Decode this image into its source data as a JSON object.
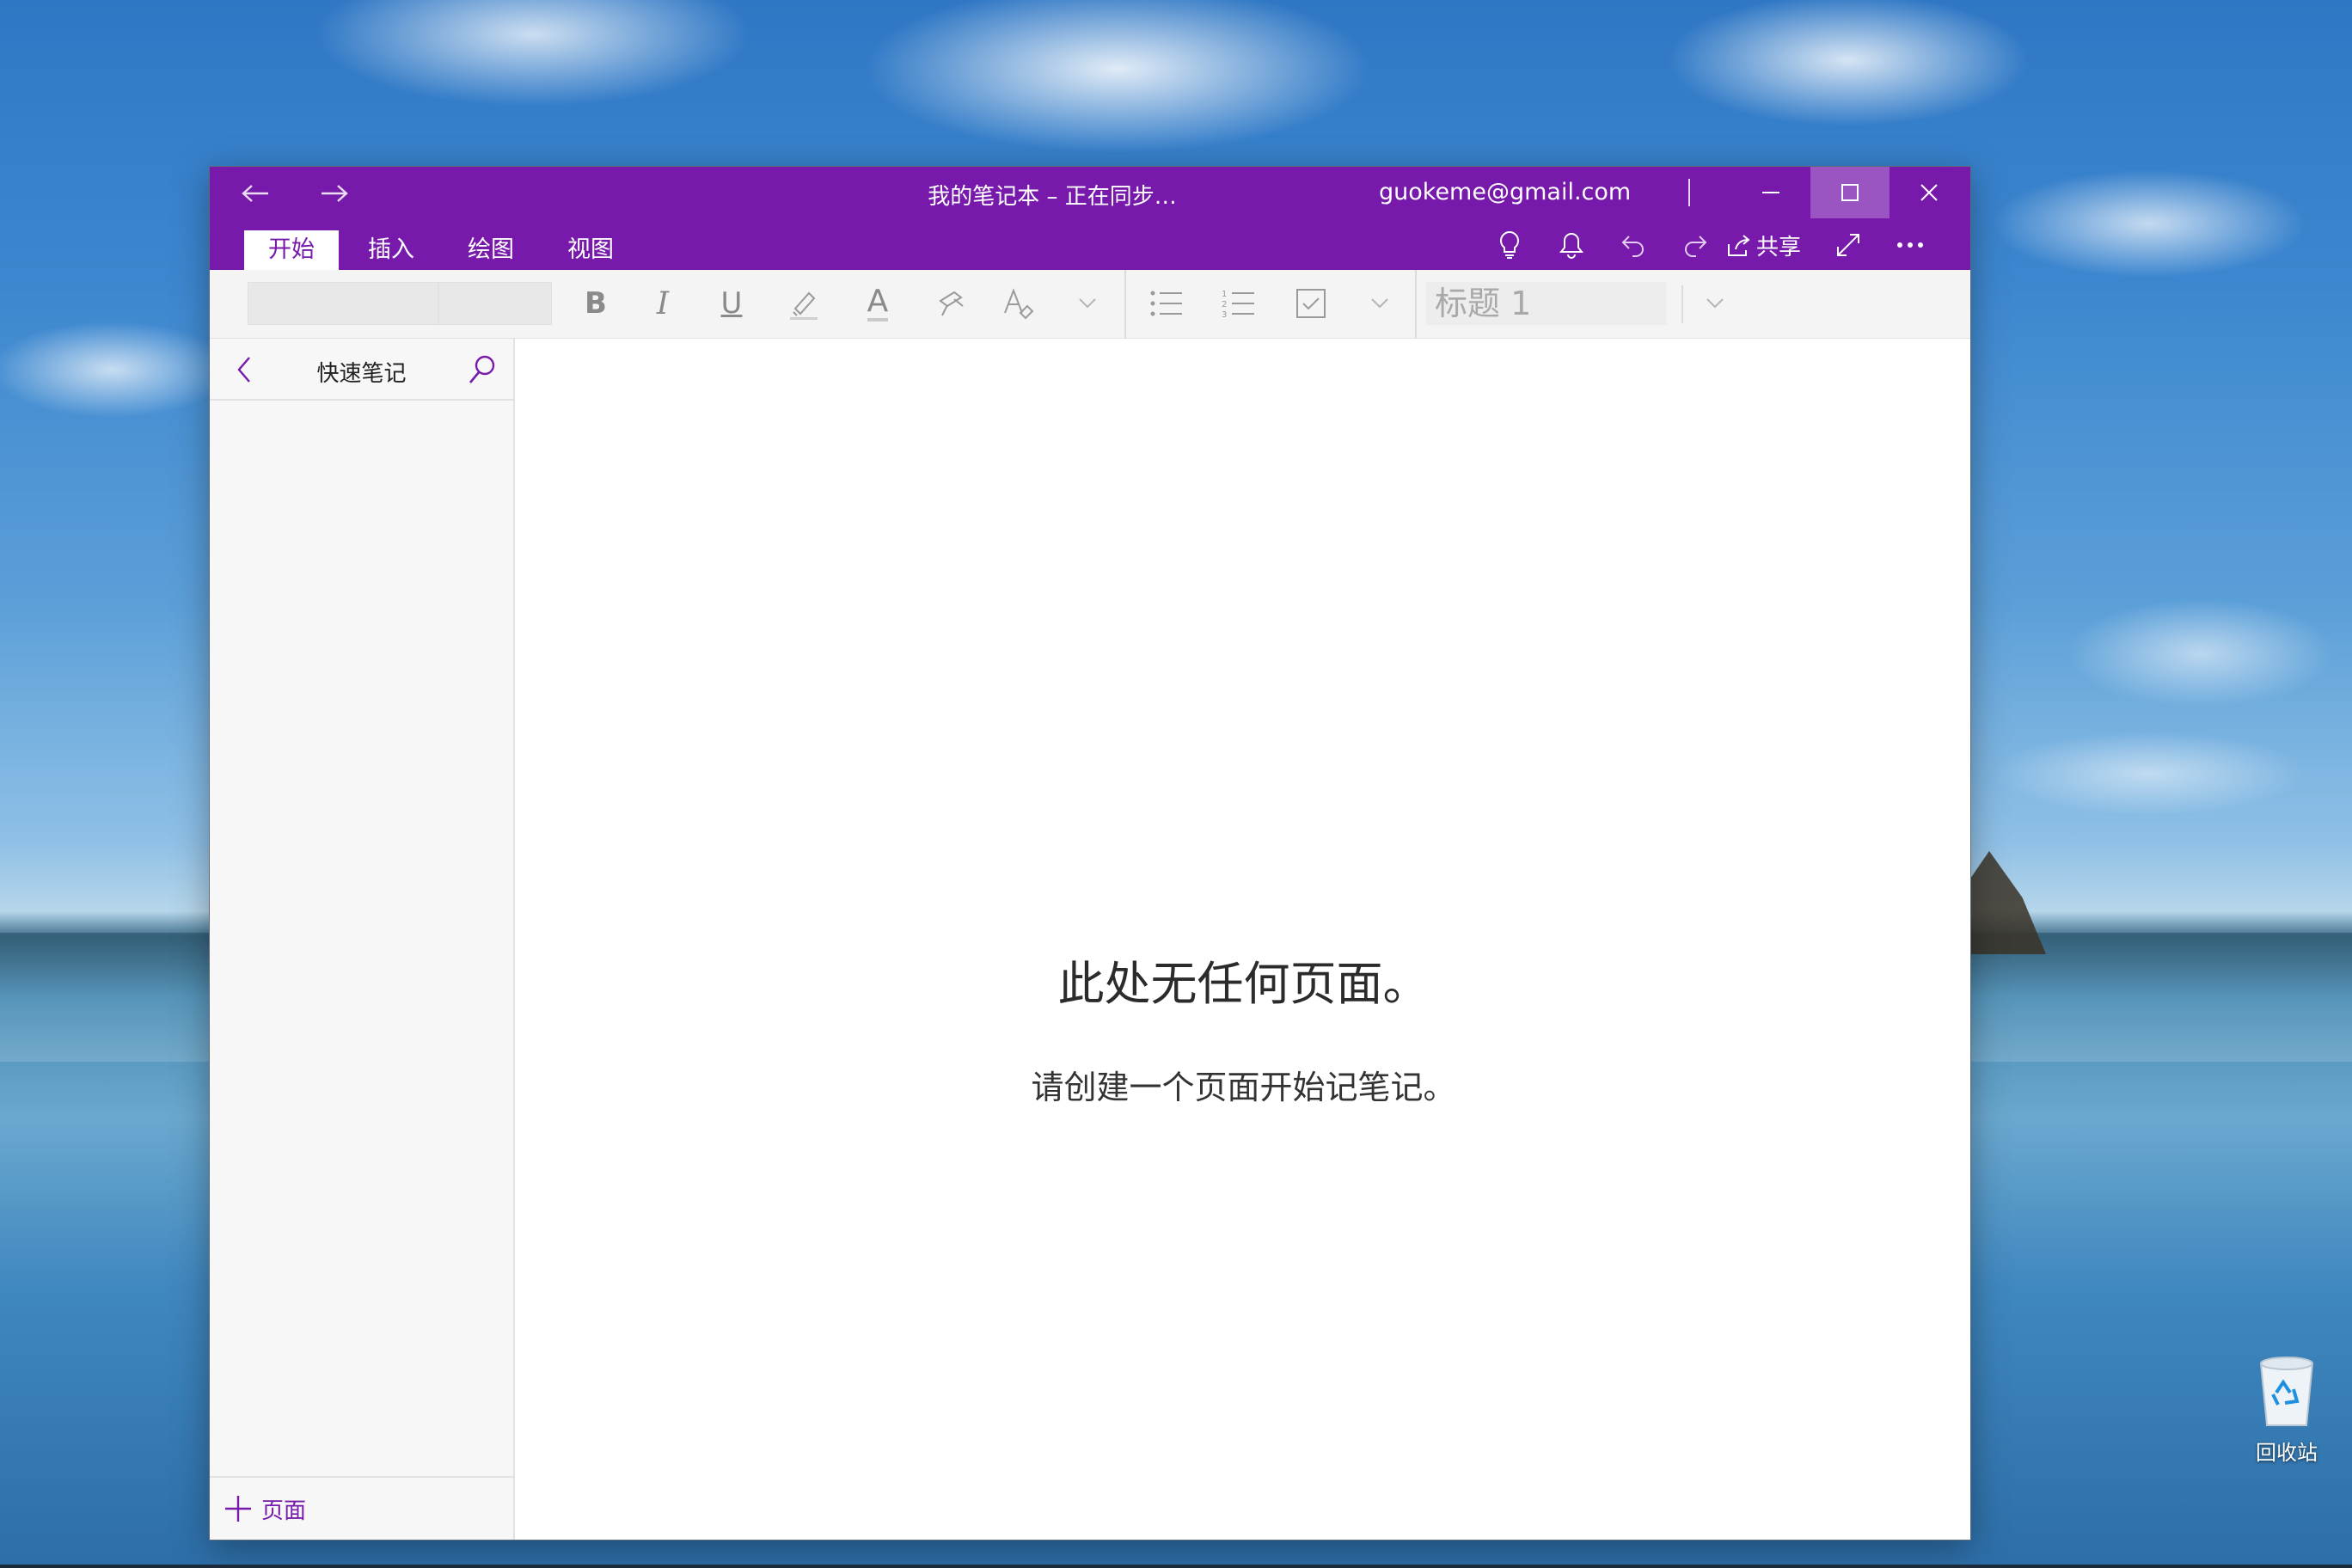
{
  "window": {
    "title": "我的笔记本 – 正在同步…",
    "account": "guokeme@gmail.com",
    "accent_color": "#7719aa"
  },
  "titlebar": {
    "back_icon": "arrow-left-icon",
    "forward_icon": "arrow-right-icon",
    "minimize_icon": "minimize-icon",
    "maximize_icon": "maximize-icon",
    "close_icon": "close-icon"
  },
  "ribbon": {
    "tabs": [
      {
        "label": "开始",
        "active": true
      },
      {
        "label": "插入",
        "active": false
      },
      {
        "label": "绘图",
        "active": false
      },
      {
        "label": "视图",
        "active": false
      }
    ],
    "share_label": "共享",
    "icons": [
      "lightbulb-icon",
      "bell-icon",
      "undo-icon",
      "redo-icon",
      "share-icon",
      "fullscreen-icon",
      "more-icon"
    ]
  },
  "toolbar": {
    "font_name": "",
    "font_size": "",
    "bold_glyph": "B",
    "italic_glyph": "I",
    "underline_glyph": "U",
    "font_color_glyph": "A",
    "style_value": "标题 1"
  },
  "left_pane": {
    "section_title": "快速笔记",
    "add_page_label": "页面"
  },
  "canvas": {
    "empty_title": "此处无任何页面。",
    "empty_subtitle": "请创建一个页面开始记笔记。"
  },
  "desktop": {
    "recycle_bin_label": "回收站"
  }
}
